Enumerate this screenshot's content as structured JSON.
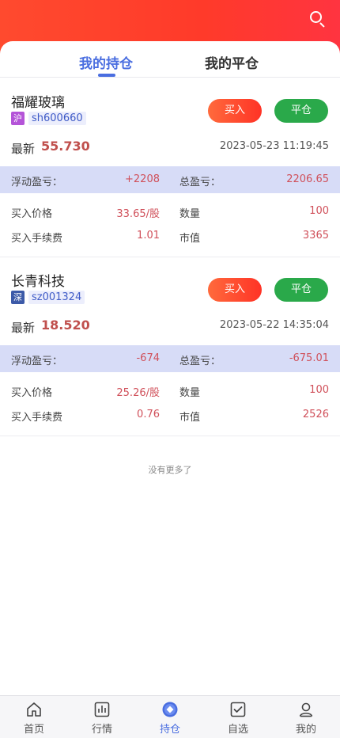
{
  "header": {
    "search_icon": "search-icon"
  },
  "tabs": [
    {
      "label": "我的持仓",
      "active": true
    },
    {
      "label": "我的平仓",
      "active": false
    }
  ],
  "positions": [
    {
      "name": "福耀玻璃",
      "exchange": "沪",
      "code": "sh600660",
      "buy_label": "买入",
      "close_label": "平仓",
      "latest_label": "最新",
      "latest_value": "55.730",
      "time": "2023-05-23 11:19:45",
      "float_pnl_label": "浮动盈亏：",
      "float_pnl_value": "+2208",
      "total_pnl_label": "总盈亏：",
      "total_pnl_value": "2206.65",
      "buy_price_label": "买入价格",
      "buy_price_value": "33.65/股",
      "quantity_label": "数量",
      "quantity_value": "100",
      "fee_label": "买入手续费",
      "fee_value": "1.01",
      "market_value_label": "市值",
      "market_value_value": "3365"
    },
    {
      "name": "长青科技",
      "exchange": "深",
      "code": "sz001324",
      "buy_label": "买入",
      "close_label": "平仓",
      "latest_label": "最新",
      "latest_value": "18.520",
      "time": "2023-05-22 14:35:04",
      "float_pnl_label": "浮动盈亏：",
      "float_pnl_value": "-674",
      "total_pnl_label": "总盈亏：",
      "total_pnl_value": "-675.01",
      "buy_price_label": "买入价格",
      "buy_price_value": "25.26/股",
      "quantity_label": "数量",
      "quantity_value": "100",
      "fee_label": "买入手续费",
      "fee_value": "0.76",
      "market_value_label": "市值",
      "market_value_value": "2526"
    }
  ],
  "no_more_text": "没有更多了",
  "nav": [
    {
      "label": "首页",
      "icon": "home-icon",
      "active": false
    },
    {
      "label": "行情",
      "icon": "chart-icon",
      "active": false
    },
    {
      "label": "持仓",
      "icon": "holdings-icon",
      "active": true
    },
    {
      "label": "自选",
      "icon": "watchlist-icon",
      "active": false
    },
    {
      "label": "我的",
      "icon": "profile-icon",
      "active": false
    }
  ],
  "colors": {
    "header_red": "#ff4a2e",
    "accent_blue": "#4a6ee0",
    "buy_button": "#ff3326",
    "close_button": "#2aa94a",
    "pnl_band": "#d7dcf7",
    "value_red": "#d0505a"
  }
}
